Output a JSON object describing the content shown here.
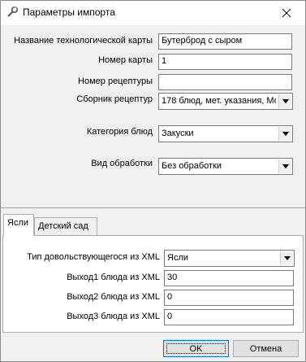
{
  "window": {
    "title": "Параметры импорта"
  },
  "main": {
    "tech_card_name": {
      "label": "Название технологической карты",
      "value": "Бутерброд с сыром"
    },
    "card_number": {
      "label": "Номер карты",
      "value": "1"
    },
    "recipe_number": {
      "label": "Номер рецептуры",
      "value": ""
    },
    "recipe_collection": {
      "label": "Сборник рецептур",
      "value": "178 блюд, мет. указания, Мо"
    },
    "dish_category": {
      "label": "Категория блюд",
      "value": "Закуски"
    },
    "processing_type": {
      "label": "Вид обработки",
      "value": "Без обработки"
    }
  },
  "tabs": [
    {
      "label": "Ясли"
    },
    {
      "label": "Детский сад"
    }
  ],
  "tab_content": {
    "allowance_type": {
      "label": "Тип довольствующегося из XML",
      "value": "Ясли"
    },
    "output1": {
      "label": "Выход1 блюда из XML",
      "value": "30"
    },
    "output2": {
      "label": "Выход2 блюда из XML",
      "value": "0"
    },
    "output3": {
      "label": "Выход3 блюда из XML",
      "value": "0"
    }
  },
  "buttons": {
    "ok": "OK",
    "cancel": "Отмена"
  },
  "icons": {
    "title": "wrench-icon",
    "close": "close-icon",
    "dropdown": "chevron-down-icon"
  }
}
